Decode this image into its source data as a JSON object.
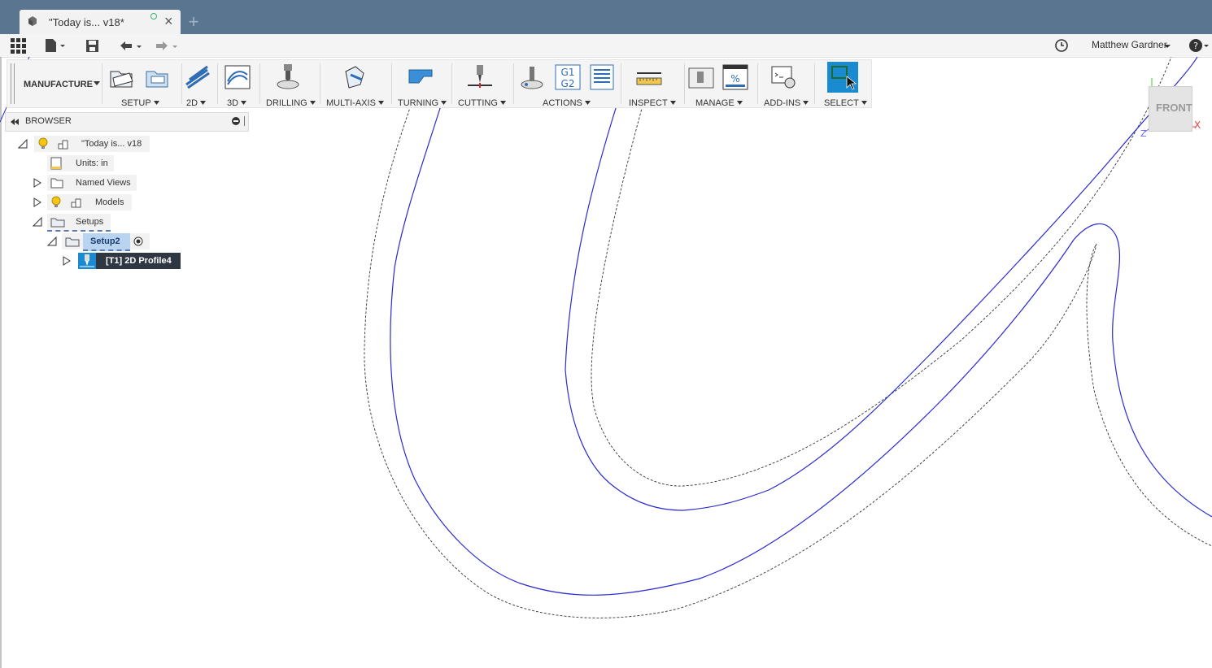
{
  "tab": {
    "title": "\"Today is... v18*"
  },
  "user": {
    "name": "Matthew Gardner"
  },
  "toolbar": {
    "workspace": "MANUFACTURE",
    "groups": [
      "SETUP",
      "2D",
      "3D",
      "DRILLING",
      "MULTI-AXIS",
      "TURNING",
      "CUTTING",
      "ACTIONS",
      "INSPECT",
      "MANAGE",
      "ADD-INS",
      "SELECT"
    ]
  },
  "browser": {
    "title": "BROWSER",
    "items": {
      "root": "\"Today is... v18",
      "units": "Units: in",
      "named_views": "Named Views",
      "models": "Models",
      "setups": "Setups",
      "setup2": "Setup2",
      "operation": "[T1] 2D Profile4"
    }
  },
  "viewcube": {
    "face": "FRONT",
    "axis_x": "X",
    "axis_z": "Z"
  },
  "colors": {
    "titlebar": "#5a7590",
    "toolpath": "#2a2ad0",
    "select_active": "#1a8bd1",
    "selected_row": "#2f3742"
  }
}
